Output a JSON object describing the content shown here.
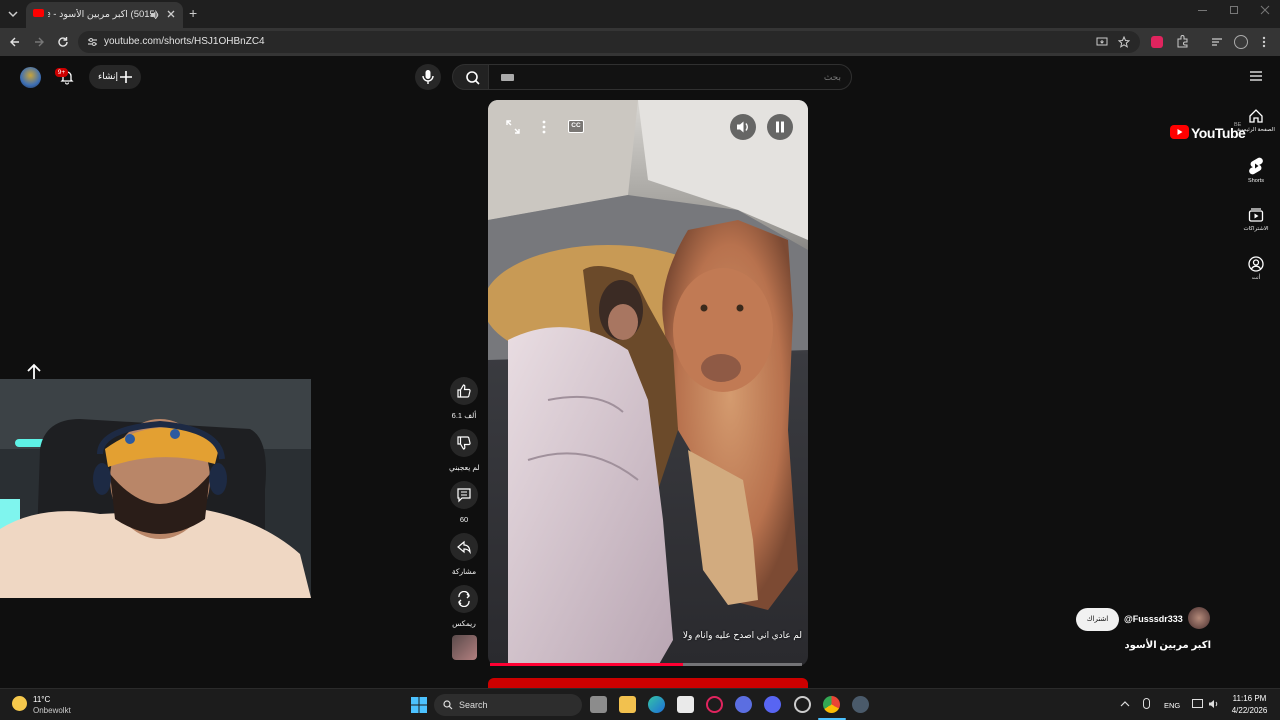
{
  "browser": {
    "tab_title": "(5015) اكبر مربين الأسود - YouTube",
    "new_tab_label": "+",
    "url": "youtube.com/shorts/HSJ1OHBnZC4"
  },
  "header": {
    "search_placeholder": "بحث",
    "create_label": "إنشاء",
    "notification_count": "9+",
    "logo_text": "YouTube",
    "logo_country": "BE"
  },
  "guide": {
    "items": [
      {
        "label": "الصفحة الرئيسية",
        "icon": "home-icon"
      },
      {
        "label": "Shorts",
        "icon": "shorts-icon"
      },
      {
        "label": "الاشتراكات",
        "icon": "subscriptions-icon"
      },
      {
        "label": "أنت",
        "icon": "you-icon"
      }
    ]
  },
  "video": {
    "caption": "لم عادي اني اصدح عليه وانام ولا",
    "progress": 0.62,
    "controls": {
      "cc_label": "CC"
    }
  },
  "actions": {
    "like_count": "6.1 ألف",
    "dislike_label": "لم يعجبني",
    "comment_count": "60",
    "share_label": "مشاركة",
    "remix_label": "ريمكس"
  },
  "channel": {
    "handle": "@Fusssdr333",
    "subscribe_label": "اشتراك",
    "video_title": "اكبر مربين الأسود"
  },
  "taskbar": {
    "temperature": "11°C",
    "weather": "Onbewolkt",
    "search_label": "Search",
    "language": "ENG",
    "time": "11:16 PM",
    "date": "4/22/2026"
  },
  "colors": {
    "accent": "#ff0033",
    "background": "#0f0f0f",
    "youtube_red": "#ff0000"
  }
}
